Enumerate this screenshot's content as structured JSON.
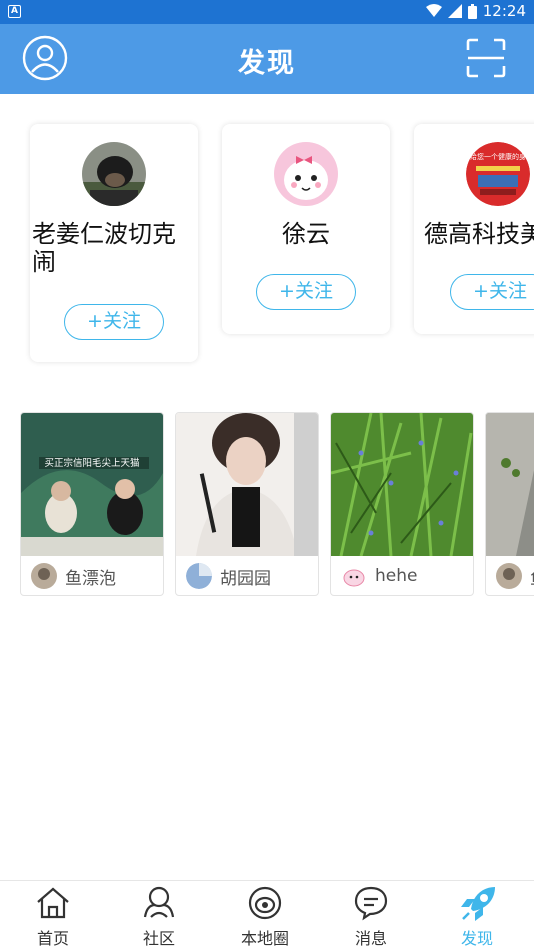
{
  "status_bar": {
    "time": "12:24",
    "app_badge": "A"
  },
  "header": {
    "title": "发现"
  },
  "recommended_users": [
    {
      "name": "老姜仁波切克闹",
      "follow_label": "+关注"
    },
    {
      "name": "徐云",
      "follow_label": "+关注"
    },
    {
      "name": "德高科技美",
      "follow_label": "+关注"
    }
  ],
  "avatar_image_text": "给您一个健康的身",
  "photo_posts": [
    {
      "author": "鱼漂泡",
      "image_caption": "买正宗信阳毛尖上天猫"
    },
    {
      "author": "胡园园"
    },
    {
      "author": "hehe"
    },
    {
      "author": "鱼"
    }
  ],
  "tabs": [
    {
      "label": "首页",
      "icon": "home-icon"
    },
    {
      "label": "社区",
      "icon": "community-icon"
    },
    {
      "label": "本地圈",
      "icon": "local-circle-icon"
    },
    {
      "label": "消息",
      "icon": "message-icon"
    },
    {
      "label": "发现",
      "icon": "discover-rocket-icon",
      "active": true
    }
  ],
  "colors": {
    "header": "#4d9ae6",
    "status_bar": "#1e73d2",
    "accent": "#3fb6ea"
  }
}
